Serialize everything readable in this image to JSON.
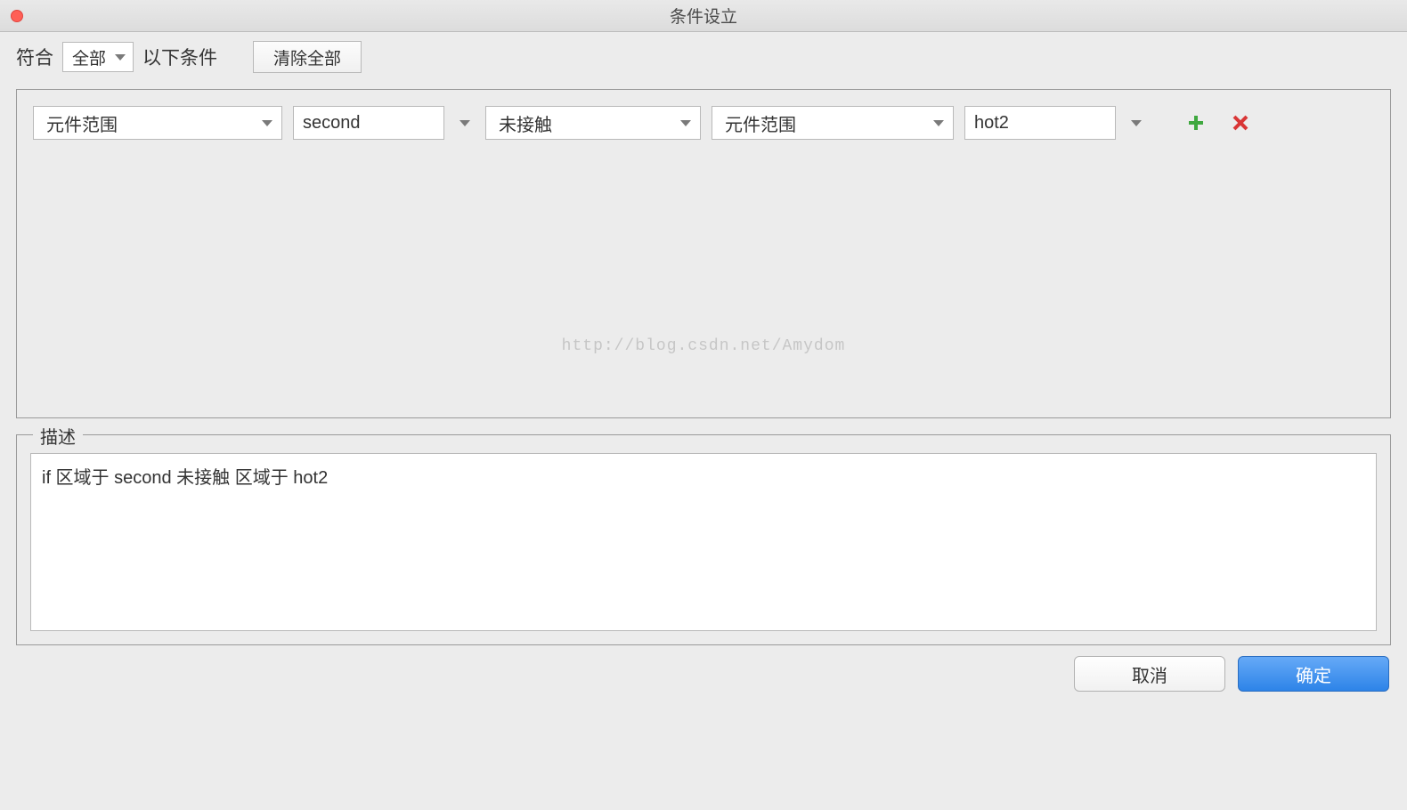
{
  "window": {
    "title": "条件设立"
  },
  "toolbar": {
    "match_prefix": "符合",
    "match_selector": "全部",
    "match_suffix": "以下条件",
    "clear_all": "清除全部"
  },
  "condition_row": {
    "widget_scope1": "元件范围",
    "second_value": "second",
    "action": "未接触",
    "widget_scope2": "元件范围",
    "hot_value": "hot2"
  },
  "watermark": "http://blog.csdn.net/Amydom",
  "description": {
    "legend": "描述",
    "text": "if 区域于 second 未接触 区域于 hot2"
  },
  "footer": {
    "cancel": "取消",
    "ok": "确定"
  }
}
